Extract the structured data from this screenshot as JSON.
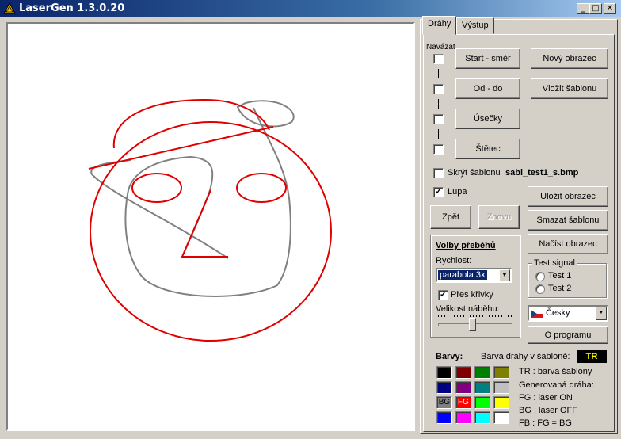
{
  "window": {
    "title": "LaserGen 1.3.0.20",
    "minimize": "_",
    "maximize": "□",
    "close": "✕"
  },
  "tabs": [
    {
      "label": "Dráhy",
      "active": true
    },
    {
      "label": "Výstup",
      "active": false
    }
  ],
  "navazat": {
    "label": "Navázat",
    "checks": [
      false,
      false,
      false,
      false
    ]
  },
  "tools": {
    "start_smer": "Start - směr",
    "od_do": "Od - do",
    "usecky": "Úsečky",
    "stetec": "Štětec"
  },
  "actions": {
    "novy_obrazec": "Nový obrazec",
    "vlozit_sablonu": "Vložit šablonu",
    "ulozit_obrazec": "Uložit obrazec",
    "smazat_sablonu": "Smazat šablonu",
    "nacist_obrazec": "Načíst obrazec",
    "o_programu": "O programu"
  },
  "template": {
    "skryt_label": "Skrýt šablonu",
    "skryt_checked": false,
    "filename": "sabl_test1_s.bmp"
  },
  "lupa": {
    "label": "Lupa",
    "checked": true
  },
  "history": {
    "zpet": "Zpět",
    "znovu": "Znovu"
  },
  "volby": {
    "title": "Volby přeběhů",
    "rychlost_label": "Rychlost:",
    "rychlost_value": "parabola 3x",
    "pres_krivky_label": "Přes křivky",
    "pres_krivky_checked": true,
    "velikost_label": "Velikost náběhu:",
    "slider_value": 0.46
  },
  "test_signal": {
    "title": "Test signal",
    "options": [
      "Test 1",
      "Test 2"
    ]
  },
  "language": {
    "value": "Česky"
  },
  "colors": {
    "title": "Barvy:",
    "template_color_label": "Barva dráhy v šabloně:",
    "template_color_tag": "TR",
    "legend": [
      "TR : barva šablony",
      "Generovaná dráha:",
      "FG : laser ON",
      "BG : laser OFF",
      "FB : FG = BG"
    ],
    "palette": [
      {
        "hex": "#000000",
        "tag": ""
      },
      {
        "hex": "#800000",
        "tag": ""
      },
      {
        "hex": "#008000",
        "tag": ""
      },
      {
        "hex": "#808000",
        "tag": ""
      },
      {
        "hex": "#000080",
        "tag": ""
      },
      {
        "hex": "#800080",
        "tag": ""
      },
      {
        "hex": "#008080",
        "tag": ""
      },
      {
        "hex": "#c0c0c0",
        "tag": ""
      },
      {
        "hex": "#808080",
        "tag": "BG"
      },
      {
        "hex": "#ff0000",
        "tag": "FG"
      },
      {
        "hex": "#00ff00",
        "tag": ""
      },
      {
        "hex": "#ffff00",
        "tag": ""
      },
      {
        "hex": "#0000ff",
        "tag": ""
      },
      {
        "hex": "#ff00ff",
        "tag": ""
      },
      {
        "hex": "#00ffff",
        "tag": ""
      },
      {
        "hex": "#ffffff",
        "tag": ""
      }
    ]
  },
  "drawing": {
    "path_color": "#e00000",
    "template_color": "#808080"
  }
}
